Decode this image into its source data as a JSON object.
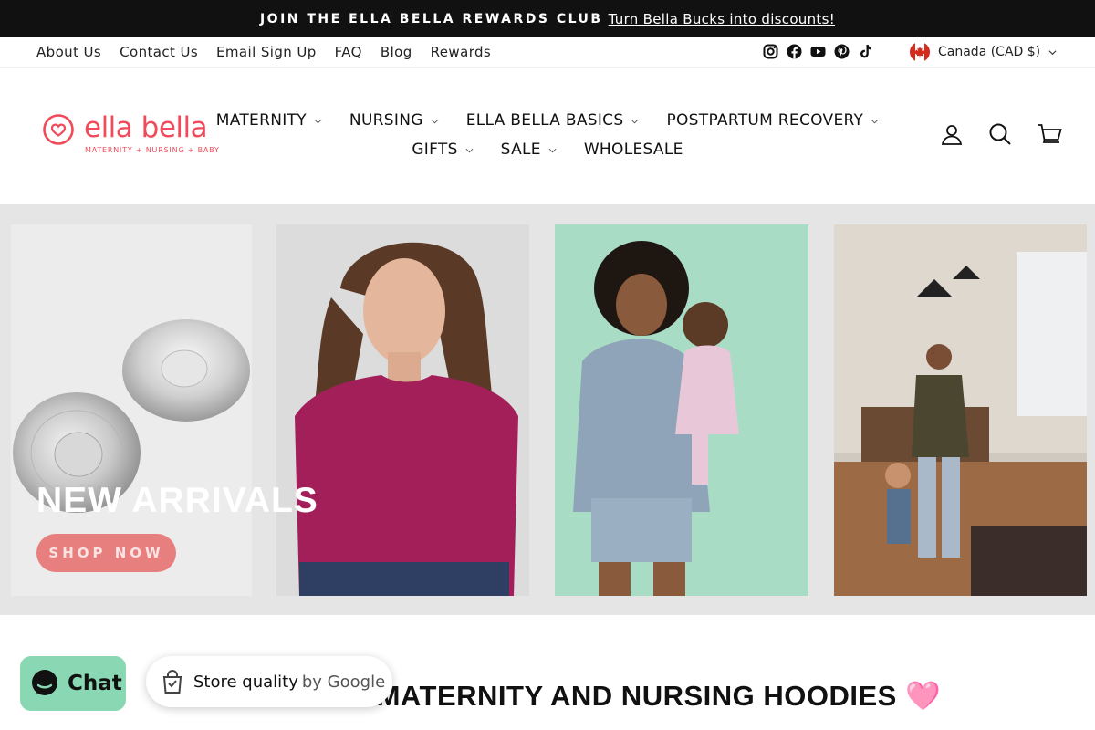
{
  "announcement": {
    "strong": "JOIN THE ELLA BELLA REWARDS CLUB",
    "link": "Turn Bella Bucks into discounts!"
  },
  "utility_links": [
    "About Us",
    "Contact Us",
    "Email Sign Up",
    "FAQ",
    "Blog",
    "Rewards"
  ],
  "social_icons": [
    "instagram-icon",
    "facebook-icon",
    "youtube-icon",
    "pinterest-icon",
    "tiktok-icon"
  ],
  "currency": {
    "label": "Canada (CAD $)"
  },
  "logo": {
    "word": "ella bella",
    "tagline": "MATERNITY + NURSING + BABY"
  },
  "nav": {
    "row1": [
      "MATERNITY",
      "NURSING",
      "ELLA BELLA BASICS",
      "POSTPARTUM RECOVERY"
    ],
    "row2": [
      "GIFTS",
      "SALE",
      "WHOLESALE"
    ]
  },
  "header_icons": [
    "account-icon",
    "search-icon",
    "cart-icon"
  ],
  "hero": {
    "title": "NEW ARRIVALS",
    "button": "SHOP NOW"
  },
  "section_title": "NG MATERNITY AND NURSING HOODIES 🩷",
  "chat": {
    "label": "Chat"
  },
  "store_quality": {
    "label": "Store quality",
    "suffix": "by Google"
  },
  "colors": {
    "brand": "#ef4b5a",
    "announce_bg": "#111111",
    "button": "#e87f7f",
    "chat_bg": "#8ad7b3"
  }
}
